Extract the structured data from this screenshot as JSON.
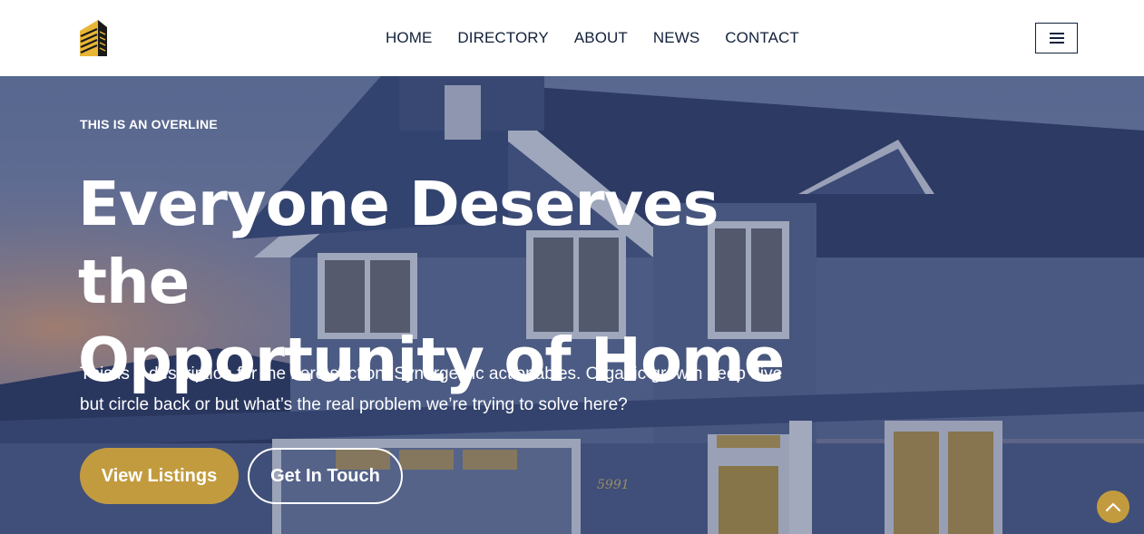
{
  "header": {
    "logo_icon": "building-logo-icon",
    "nav": [
      {
        "label": "HOME"
      },
      {
        "label": "DIRECTORY"
      },
      {
        "label": "ABOUT"
      },
      {
        "label": "NEWS"
      },
      {
        "label": "CONTACT"
      }
    ],
    "menu_icon": "hamburger-menu-icon"
  },
  "hero": {
    "overline": "THIS IS AN OVERLINE",
    "title_line1": "Everyone Deserves the",
    "title_line2": "Opportunity of Home",
    "description_line1": "This is a description for the hero section. Synergestic actionables. Organic growth deep dive",
    "description_line2": "but circle back or but what’s the real problem we’re trying to solve here?",
    "primary_button": "View Listings",
    "secondary_button": "Get In Touch",
    "house_number": "5991"
  },
  "scroll_top_icon": "chevron-up-icon",
  "colors": {
    "accent": "#c39b3f",
    "nav_text": "#11213a",
    "hero_overlay": "#28375f"
  }
}
